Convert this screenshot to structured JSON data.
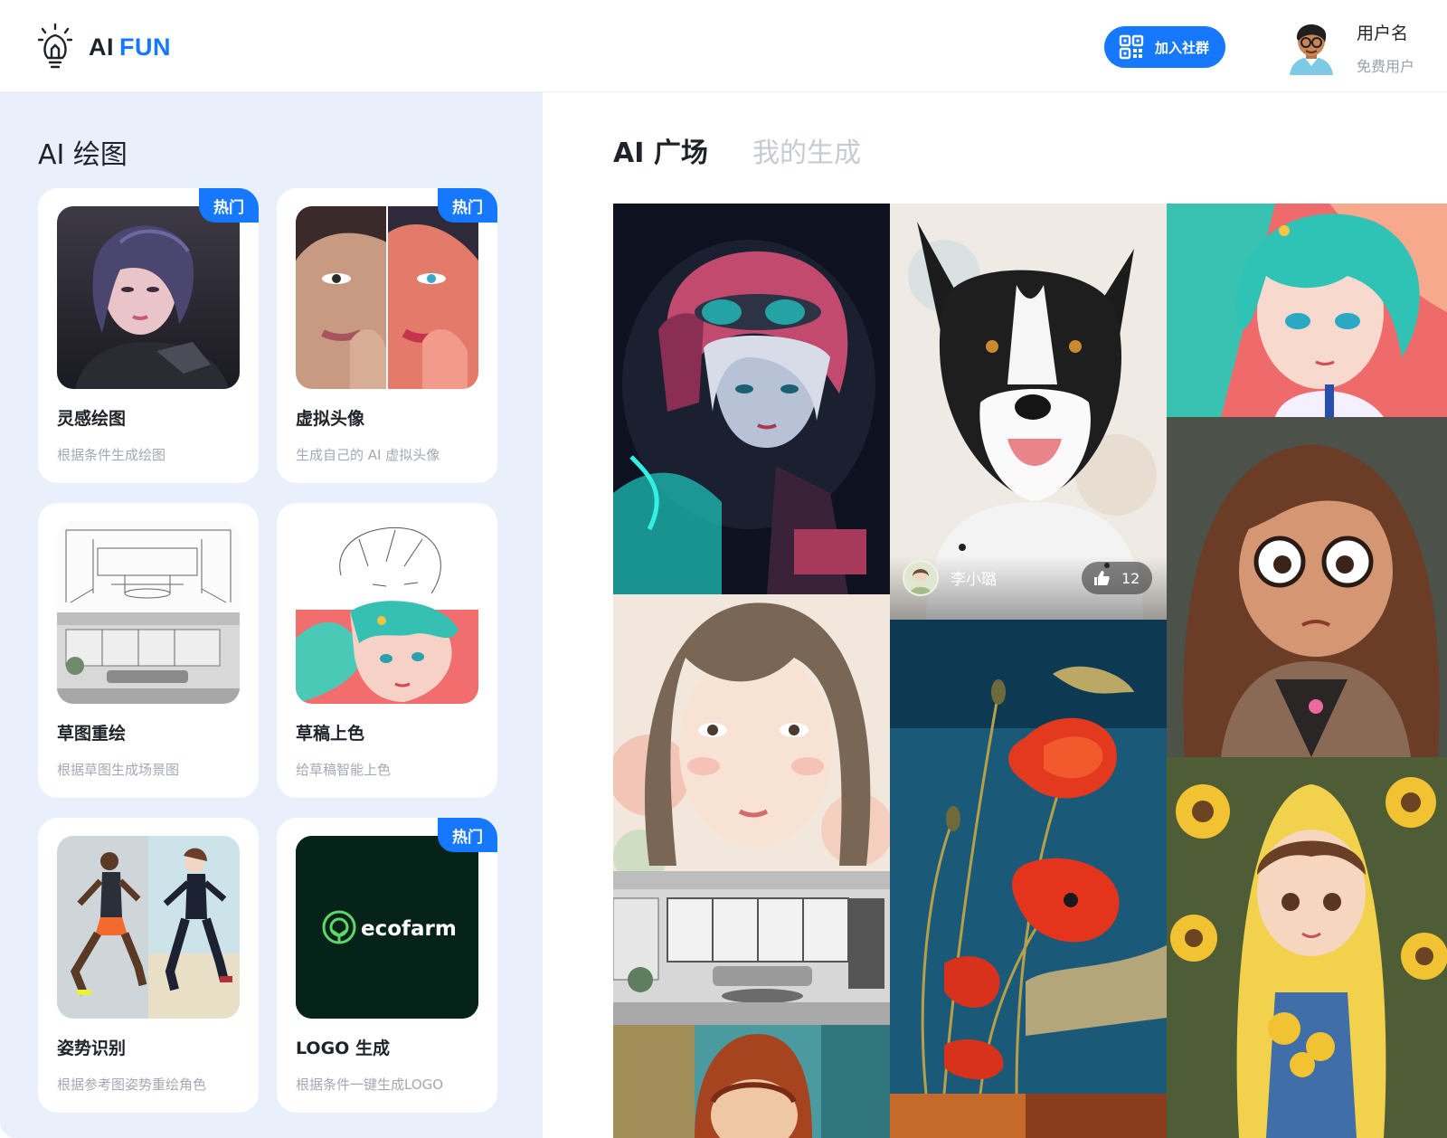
{
  "header": {
    "logo_ai": "AI",
    "logo_fun": "FUN",
    "join_label": "加入社群",
    "user_name": "用户名",
    "user_type": "免费用户"
  },
  "left": {
    "title": "AI 绘图",
    "hot_label": "热门",
    "cards": [
      {
        "title": "灵感绘图",
        "desc": "根据条件生成绘图",
        "hot": true
      },
      {
        "title": "虚拟头像",
        "desc": "生成自己的 AI 虚拟头像",
        "hot": true
      },
      {
        "title": "草图重绘",
        "desc": "根据草图生成场景图",
        "hot": false
      },
      {
        "title": "草稿上色",
        "desc": "给草稿智能上色",
        "hot": false
      },
      {
        "title": "姿势识别",
        "desc": "根据参考图姿势重绘角色",
        "hot": false
      },
      {
        "title": "LOGO 生成",
        "desc": "根据条件一键生成LOGO",
        "hot": true
      }
    ],
    "ecofarm_text": "ecofarm"
  },
  "tabs": {
    "plaza": "AI 广场",
    "mine": "我的生成"
  },
  "gallery": {
    "author_name": "李小璐",
    "likes": "12"
  },
  "colors": {
    "accent": "#1677ff",
    "panel_bg": "#e9f0fb"
  }
}
